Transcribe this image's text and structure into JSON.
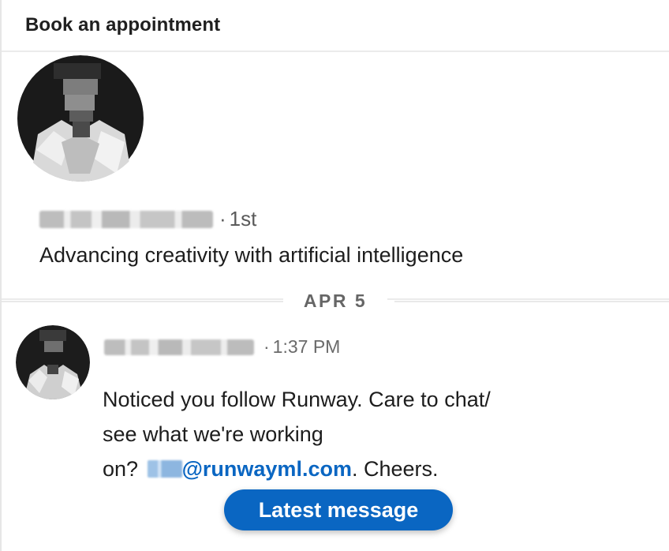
{
  "header": {
    "title": "Book an appointment"
  },
  "profile": {
    "separator": "·",
    "degree": "1st",
    "headline": "Advancing creativity with artificial intelligence"
  },
  "conversation": {
    "date_divider": "APR 5",
    "message": {
      "separator": "·",
      "time": "1:37 PM",
      "text_part1": "Noticed you follow Runway. Care to chat/",
      "text_part2": "see what we're working",
      "text_part3": "on?",
      "email_domain": "@runwayml.com",
      "text_part4": ". Cheers."
    }
  },
  "latest_button": {
    "label": "Latest message"
  },
  "colors": {
    "accent": "#0a66c2",
    "divider": "#ebebeb",
    "muted_text": "#666666"
  }
}
